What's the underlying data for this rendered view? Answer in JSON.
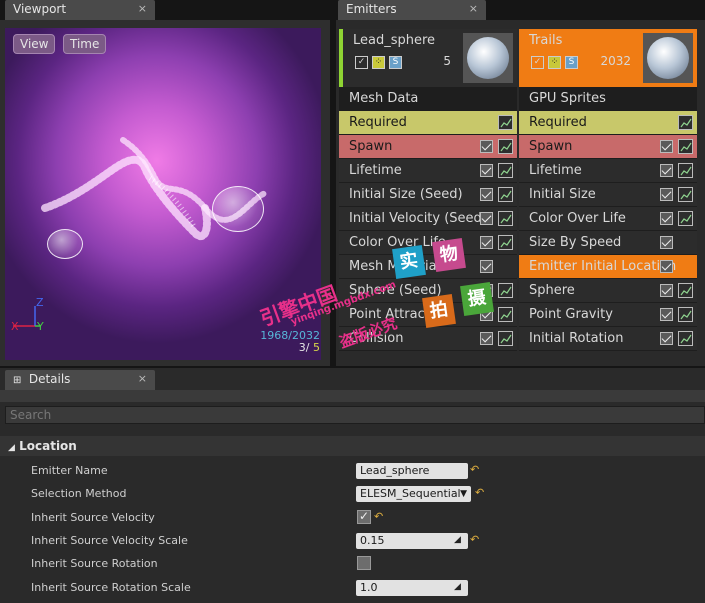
{
  "tabs": {
    "viewport": "Viewport",
    "emitters": "Emitters",
    "details": "Details",
    "close": "×"
  },
  "viewport": {
    "view_button": "View",
    "time_button": "Time",
    "stats_line1": "1968/2032",
    "stats_line2": "3/",
    "stats_line3": "5",
    "axes": {
      "z": "Z",
      "y": "Y",
      "x": "X"
    }
  },
  "emitters": {
    "columns": [
      {
        "name": "Lead_sphere",
        "count": "5",
        "type_row": "Mesh Data",
        "header_color": "#2c2c2c",
        "modules": [
          {
            "label": "Required",
            "color": "#c8c86a",
            "text_color": "#1a1a1a",
            "checkbox": false,
            "graph": true
          },
          {
            "label": "Spawn",
            "color": "#c86a6a",
            "text_color": "#1a1a1a",
            "checkbox": true,
            "graph": true
          },
          {
            "label": "Lifetime",
            "color": "#2c2c2c",
            "checkbox": true,
            "graph": true
          },
          {
            "label": "Initial Size (Seed)",
            "color": "#2c2c2c",
            "checkbox": true,
            "graph": true
          },
          {
            "label": "Initial Velocity (Seed)",
            "color": "#2c2c2c",
            "checkbox": true,
            "graph": true
          },
          {
            "label": "Color Over Life",
            "color": "#2c2c2c",
            "checkbox": true,
            "graph": true
          },
          {
            "label": "Mesh Material",
            "color": "#2c2c2c",
            "checkbox": true,
            "graph": false
          },
          {
            "label": "Sphere (Seed)",
            "color": "#2c2c2c",
            "checkbox": true,
            "graph": true
          },
          {
            "label": "Point Attractor",
            "color": "#2c2c2c",
            "checkbox": true,
            "graph": true
          },
          {
            "label": "Collision",
            "color": "#2c2c2c",
            "checkbox": true,
            "graph": true
          }
        ]
      },
      {
        "name": "Trails",
        "count": "2032",
        "type_row": "GPU Sprites",
        "header_color": "#f07c14",
        "modules": [
          {
            "label": "Required",
            "color": "#c8c86a",
            "text_color": "#1a1a1a",
            "checkbox": false,
            "graph": true
          },
          {
            "label": "Spawn",
            "color": "#c86a6a",
            "text_color": "#1a1a1a",
            "checkbox": true,
            "graph": true
          },
          {
            "label": "Lifetime",
            "color": "#2c2c2c",
            "checkbox": true,
            "graph": true
          },
          {
            "label": "Initial Size",
            "color": "#2c2c2c",
            "checkbox": true,
            "graph": true
          },
          {
            "label": "Color Over Life",
            "color": "#2c2c2c",
            "checkbox": true,
            "graph": true
          },
          {
            "label": "Size By Speed",
            "color": "#2c2c2c",
            "checkbox": true,
            "graph": false
          },
          {
            "label": "Emitter Initial Location",
            "color": "#f07c14",
            "checkbox": true,
            "graph": false
          },
          {
            "label": "Sphere",
            "color": "#2c2c2c",
            "checkbox": true,
            "graph": true
          },
          {
            "label": "Point Gravity",
            "color": "#2c2c2c",
            "checkbox": true,
            "graph": true
          },
          {
            "label": "Initial Rotation",
            "color": "#2c2c2c",
            "checkbox": true,
            "graph": true
          }
        ]
      }
    ]
  },
  "details": {
    "search_placeholder": "Search",
    "category": "Location",
    "properties": [
      {
        "label": "Emitter Name",
        "value": "Lead_sphere",
        "kind": "text"
      },
      {
        "label": "Selection Method",
        "value": "ELESM_Sequential",
        "kind": "dropdown"
      },
      {
        "label": "Inherit Source Velocity",
        "value": "checked",
        "kind": "checkbox"
      },
      {
        "label": "Inherit Source Velocity Scale",
        "value": "0.15",
        "kind": "number"
      },
      {
        "label": "Inherit Source Rotation",
        "value": "unchecked",
        "kind": "checkbox"
      },
      {
        "label": "Inherit Source Rotation Scale",
        "value": "1.0",
        "kind": "number"
      }
    ]
  },
  "watermark": {
    "badges": [
      "实",
      "物",
      "摄",
      "拍"
    ],
    "line1": "引擎中国",
    "line2": "yinqing.mgbdx.com",
    "line3": "盗版必究"
  }
}
